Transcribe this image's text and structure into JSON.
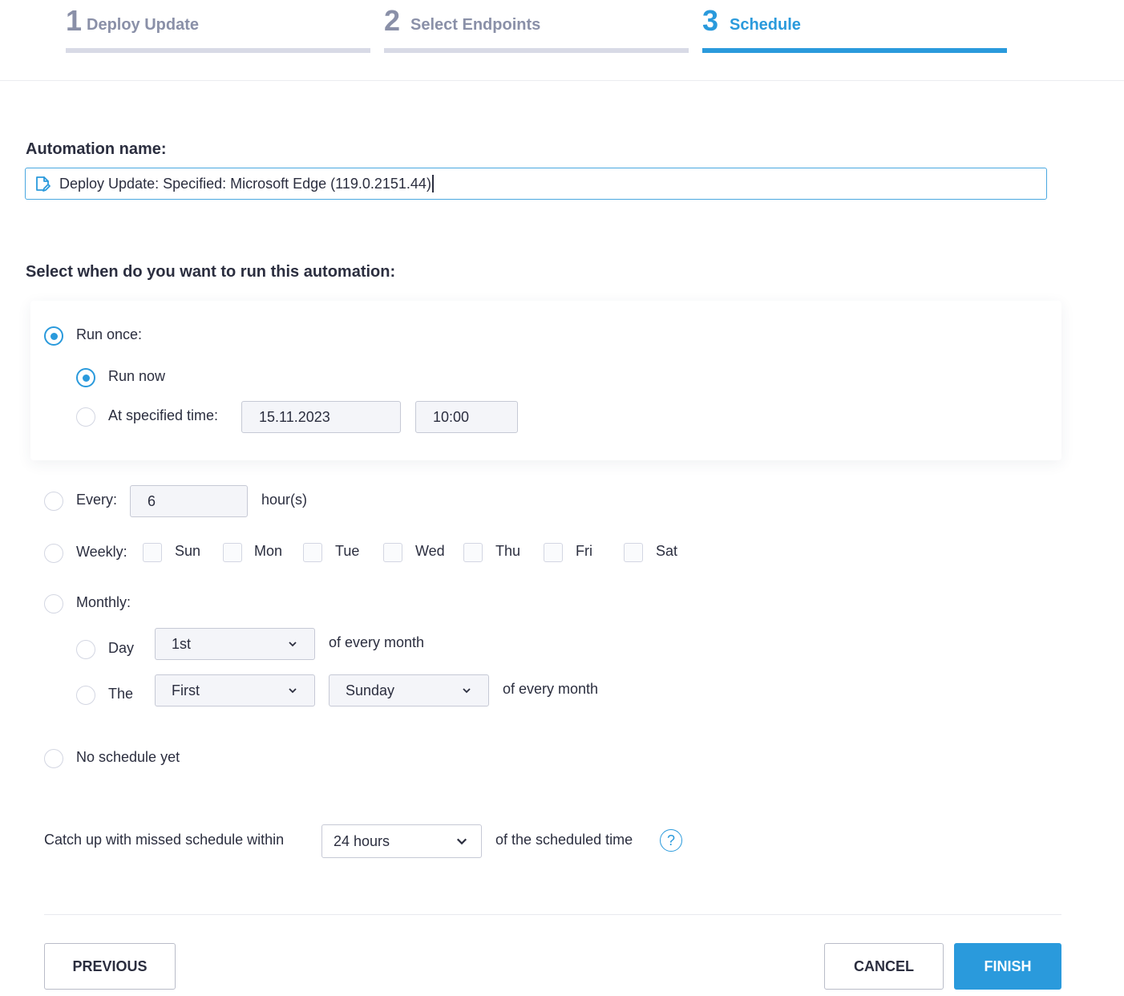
{
  "stepper": {
    "steps": [
      {
        "number": "1",
        "label": "Deploy Update",
        "active": false
      },
      {
        "number": "2",
        "label": "Select Endpoints",
        "active": false
      },
      {
        "number": "3",
        "label": "Schedule",
        "active": true
      }
    ]
  },
  "automation": {
    "label": "Automation name:",
    "value": "Deploy Update: Specified: Microsoft Edge (119.0.2151.44)",
    "icon": "edit-document-icon"
  },
  "schedule": {
    "heading": "Select when do you want to run this automation:",
    "run_once": {
      "label": "Run once:",
      "selected": true,
      "run_now": {
        "label": "Run now",
        "selected": true
      },
      "at_specified_time": {
        "label": "At specified time:",
        "selected": false,
        "date": "15.11.2023",
        "time": "10:00"
      }
    },
    "every": {
      "label": "Every:",
      "selected": false,
      "value": "6",
      "unit": "hour(s)"
    },
    "weekly": {
      "label": "Weekly:",
      "selected": false,
      "days": [
        {
          "label": "Sun",
          "checked": false
        },
        {
          "label": "Mon",
          "checked": false
        },
        {
          "label": "Tue",
          "checked": false
        },
        {
          "label": "Wed",
          "checked": false
        },
        {
          "label": "Thu",
          "checked": false
        },
        {
          "label": "Fri",
          "checked": false
        },
        {
          "label": "Sat",
          "checked": false
        }
      ]
    },
    "monthly": {
      "label": "Monthly:",
      "selected": false,
      "day_option": {
        "label": "Day",
        "selected": false,
        "value": "1st",
        "suffix": "of every month"
      },
      "the_option": {
        "label": "The",
        "selected": false,
        "ordinal": "First",
        "weekday": "Sunday",
        "suffix": "of every month"
      }
    },
    "no_schedule": {
      "label": "No schedule yet",
      "selected": false
    }
  },
  "catch_up": {
    "prefix": "Catch up with missed schedule within",
    "value": "24 hours",
    "suffix": "of the scheduled time",
    "help_icon": "?"
  },
  "footer": {
    "previous": "PREVIOUS",
    "cancel": "CANCEL",
    "finish": "FINISH"
  },
  "colors": {
    "accent": "#2a9adc",
    "inactive_step": "#8a90a8",
    "text": "#2b2e3f"
  }
}
